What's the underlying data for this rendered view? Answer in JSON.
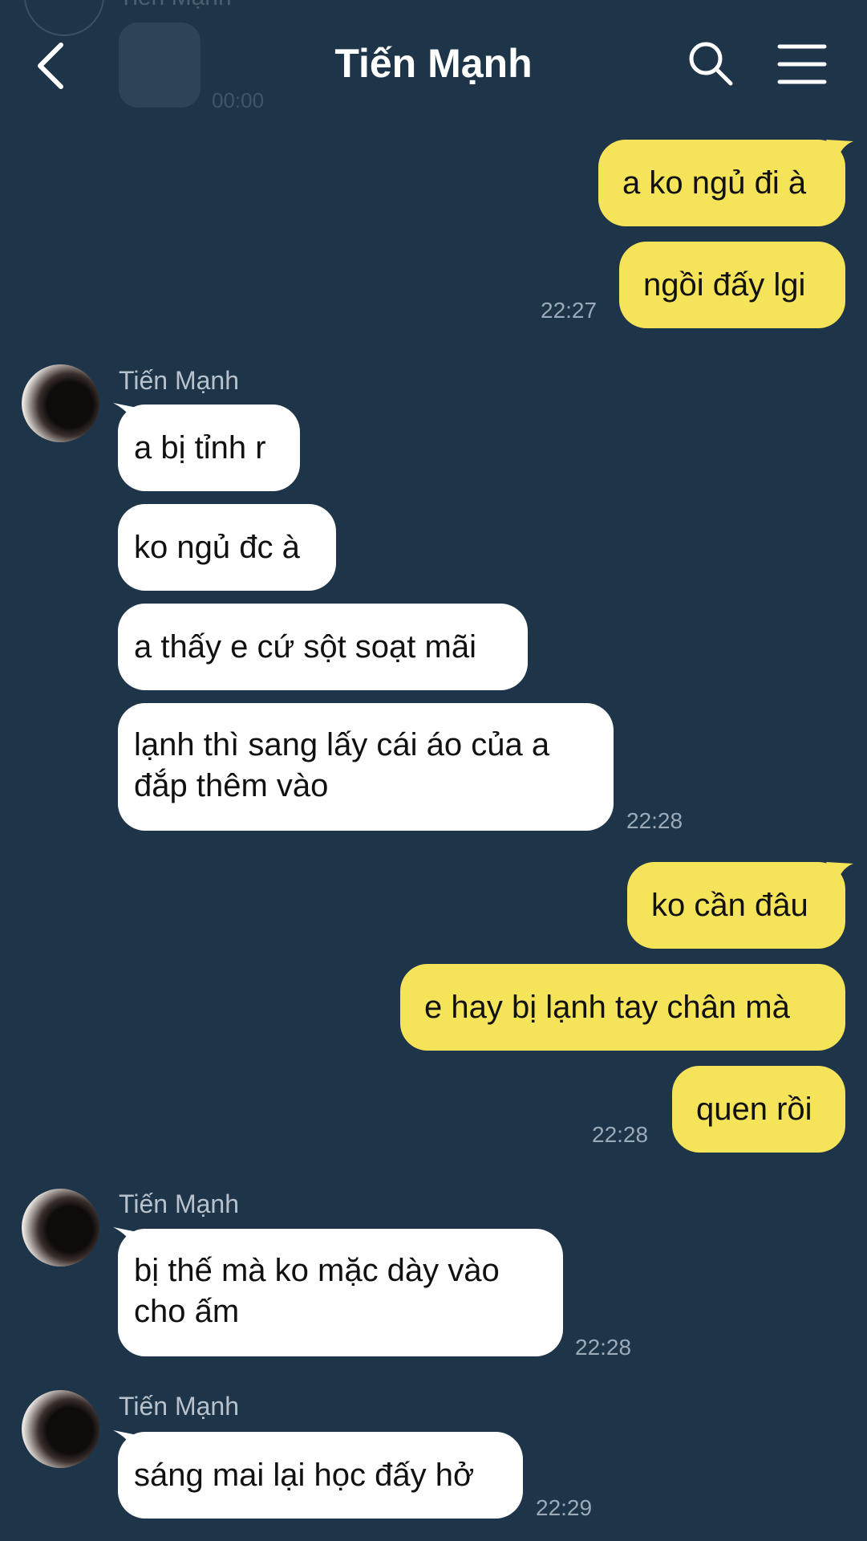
{
  "header": {
    "title": "Tiến Mạnh",
    "previous_peek": {
      "sender": "Tiến Mạnh",
      "time": "00:00"
    }
  },
  "messages": {
    "m1": "a ko ngủ đi à",
    "m2": "ngồi đấy lgi",
    "t1": "22:27",
    "s1": "Tiến Mạnh",
    "m3": "a bị tỉnh r",
    "m4": "ko ngủ đc à",
    "m5": "a thấy e cứ sột soạt mãi",
    "m6a": "lạnh thì sang lấy cái áo của a",
    "m6b": "đắp thêm vào",
    "t2": "22:28",
    "m7": "ko cần đâu",
    "m8": "e hay bị lạnh tay chân mà",
    "m9": "quen rồi",
    "t3": "22:28",
    "s2": "Tiến Mạnh",
    "m10a": "bị thế mà ko mặc dày vào",
    "m10b": "cho ấm",
    "t4": "22:28",
    "s3": "Tiến Mạnh",
    "m11": "sáng mai lại học đấy hở",
    "t5": "22:29"
  },
  "colors": {
    "background": "#1e3448",
    "incoming_bubble": "#ffffff",
    "outgoing_bubble": "#f5e35a",
    "timestamp": "#9aaab8",
    "sender_name": "#b7c2cc"
  },
  "icons": [
    "back-arrow-icon",
    "search-icon",
    "menu-icon"
  ]
}
